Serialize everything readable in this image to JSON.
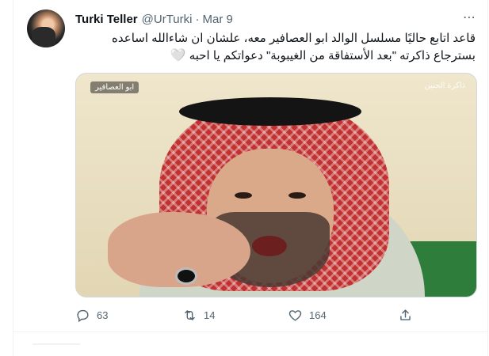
{
  "tweet": {
    "author": {
      "name": "Turki Teller",
      "handle": "@UrTurki",
      "separator": "·",
      "date": "Mar 9"
    },
    "more_icon": "ellipsis-icon",
    "text": {
      "line1": "قاعد اتابع حاليًا مسلسل الوالد ابو العصافير معه، علشان ان شاءالله اساعده",
      "line2": "بسترجاع ذاكرته \"بعد الأستفاقة من الغيبوبة\" دعواتكم يا احبه",
      "emoji": "🤍"
    },
    "media": {
      "watermark_left": "ابو العصافير",
      "watermark_right": "ذاكرة الحنين"
    },
    "actions": {
      "reply": {
        "icon": "reply-icon",
        "count": "63"
      },
      "retweet": {
        "icon": "retweet-icon",
        "count": "14"
      },
      "like": {
        "icon": "heart-icon",
        "count": "164"
      },
      "share": {
        "icon": "share-icon"
      }
    }
  },
  "colors": {
    "text_primary": "#0f1419",
    "text_secondary": "#536471",
    "border": "#eff3f4"
  }
}
